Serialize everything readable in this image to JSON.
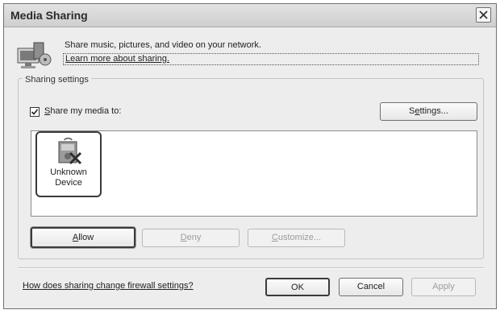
{
  "window": {
    "title": "Media Sharing"
  },
  "intro": {
    "text": "Share music, pictures, and video on your network.",
    "learn_link": "Learn more about sharing."
  },
  "sharing_settings": {
    "group_label": "Sharing settings",
    "share_checkbox": {
      "checked": true,
      "label_prefix": "",
      "label_mnemonic": "S",
      "label_rest": "hare my media to:"
    },
    "settings_button": {
      "pre": "S",
      "mnemonic": "e",
      "post": "ttings..."
    },
    "devices": [
      {
        "label": "Unknown\nDevice",
        "icon": "unknown-device-icon",
        "selected": true
      }
    ],
    "allow_button": {
      "mnemonic": "A",
      "rest": "llow"
    },
    "deny_button": {
      "mnemonic": "D",
      "rest": "eny",
      "enabled": false
    },
    "customize_button": {
      "mnemonic": "C",
      "rest": "ustomize...",
      "enabled": false
    }
  },
  "footer": {
    "firewall_link": "How does sharing change firewall settings?",
    "ok_label": "OK",
    "cancel_label": "Cancel",
    "apply_label": "Apply",
    "apply_enabled": false
  },
  "icons": {
    "close": "close-icon",
    "network": "network-media-icon",
    "device": "unknown-device-icon"
  }
}
